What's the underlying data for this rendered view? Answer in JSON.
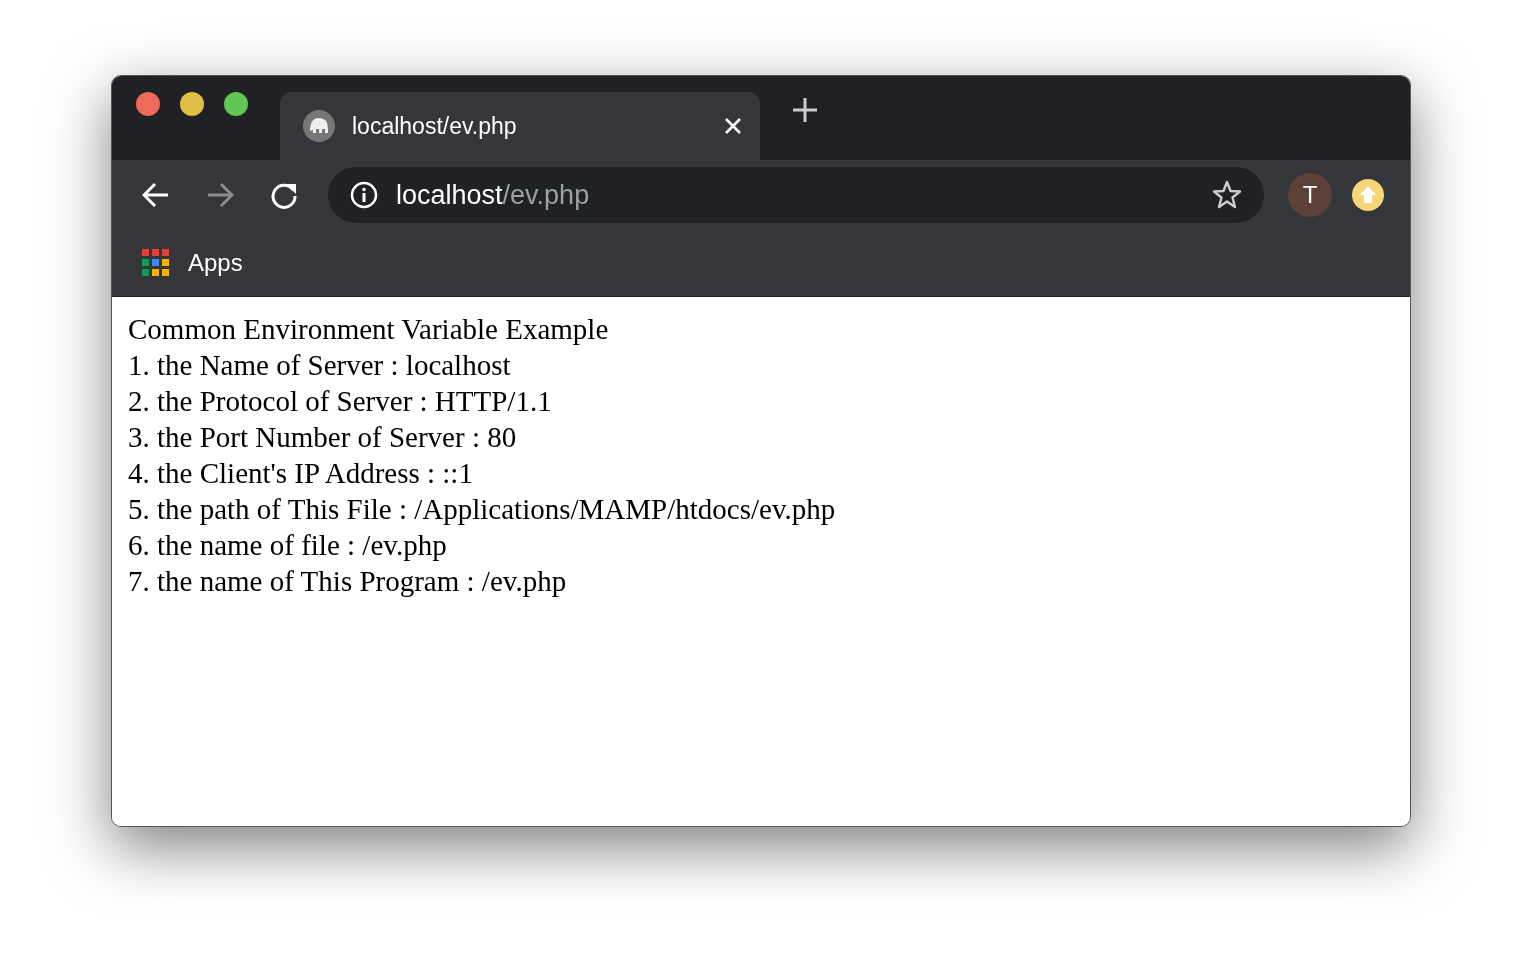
{
  "tabs": [
    {
      "title": "localhost/ev.php",
      "selected": true
    }
  ],
  "toolbar": {
    "forward": {
      "disabled": true
    },
    "address": {
      "host": "localhost",
      "path": "/ev.php"
    },
    "profile": {
      "initial": "T"
    }
  },
  "bookmarks": [
    {
      "label": "Apps"
    }
  ],
  "page": {
    "heading": "Common Environment Variable Example",
    "lines": [
      "1. the Name of Server : localhost",
      "2. the Protocol of Server : HTTP/1.1",
      "3. the Port Number of Server : 80",
      "4. the Client's IP Address : ::1",
      "5. the path of This File : /Applications/MAMP/htdocs/ev.php",
      "6. the name of file : /ev.php",
      "7. the name of This Program : /ev.php"
    ]
  }
}
